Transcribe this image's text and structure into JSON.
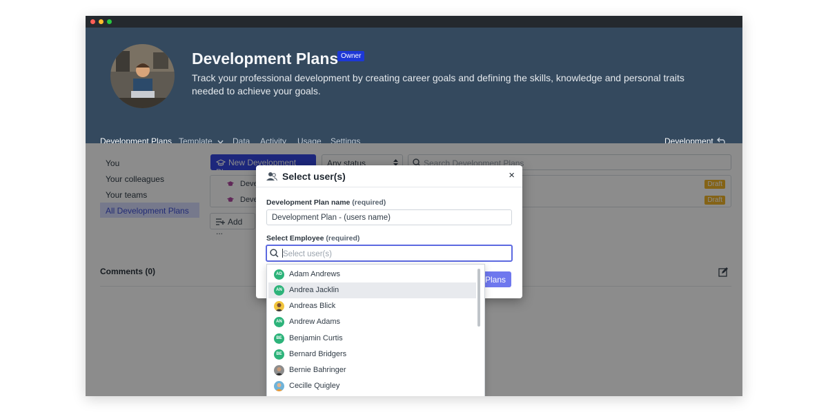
{
  "colors": {
    "accent": "#3647e2",
    "header_bg": "#34495e",
    "draft": "#f0b429",
    "nav_underline": "#e6335f",
    "initials_bg": "#2db37a"
  },
  "header": {
    "title": "Development Plans",
    "badge": "Owner",
    "description": "Track your professional development by creating career goals and defining the skills, knowledge and personal traits needed to achieve your goals."
  },
  "nav": {
    "tabs": [
      "Development Plans",
      "Template",
      "Data",
      "Activity",
      "Usage",
      "Settings"
    ],
    "right_label": "Development"
  },
  "sidebar": {
    "items": [
      "You",
      "Your colleagues",
      "Your teams",
      "All Development Plans"
    ]
  },
  "toolbar": {
    "new_button": "New Development Plan",
    "status_select": "Any status",
    "search_placeholder": "Search Development Plans"
  },
  "plans": {
    "rows": [
      {
        "label": "Deve",
        "status": "Draft"
      },
      {
        "label": "Deve",
        "status": "Draft"
      }
    ]
  },
  "add_button": "Add ...",
  "comments": {
    "label": "Comments (0)"
  },
  "modal": {
    "title": "Select user(s)",
    "close": "×",
    "plan_name_label": "Development Plan name",
    "required": "(required)",
    "plan_name_value": "Development Plan - (users name)",
    "employee_label": "Select Employee",
    "employee_placeholder": "Select user(s)",
    "action_button_partial": "Plans"
  },
  "dropdown": {
    "items": [
      {
        "name": "Adam Andrews",
        "initials": "AD"
      },
      {
        "name": "Andrea Jacklin",
        "initials": "AN"
      },
      {
        "name": "Andreas Blick",
        "initials": ""
      },
      {
        "name": "Andrew Adams",
        "initials": "AN"
      },
      {
        "name": "Benjamin Curtis",
        "initials": "BE"
      },
      {
        "name": "Bernard Bridgers",
        "initials": "BE"
      },
      {
        "name": "Bernie Bahringer",
        "initials": ""
      },
      {
        "name": "Cecille Quigley",
        "initials": ""
      }
    ]
  }
}
